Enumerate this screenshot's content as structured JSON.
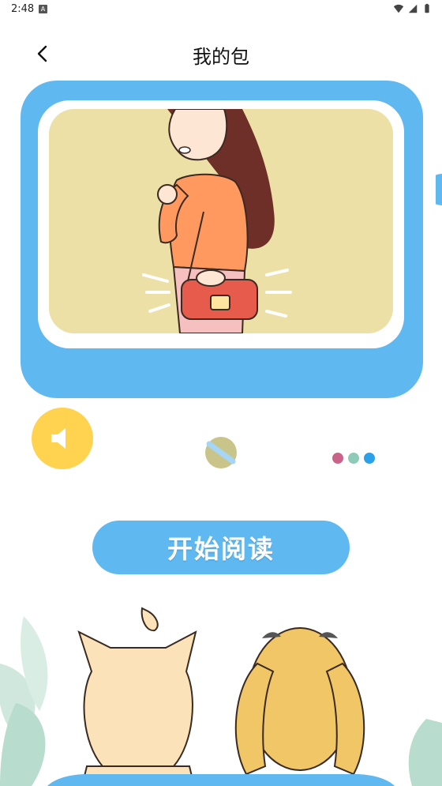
{
  "status_bar": {
    "time": "2:48",
    "notification_icon_letter": "A"
  },
  "header": {
    "title": "我的包",
    "back_icon": "chevron-left-icon"
  },
  "tv": {
    "dot_colors": [
      "#c9638a",
      "#8fc9b8",
      "#2ca0e8"
    ],
    "screen_color": "#ece0a6",
    "frame_color": "#60b8f1"
  },
  "actions": {
    "start_reading_label": "开始阅读"
  }
}
